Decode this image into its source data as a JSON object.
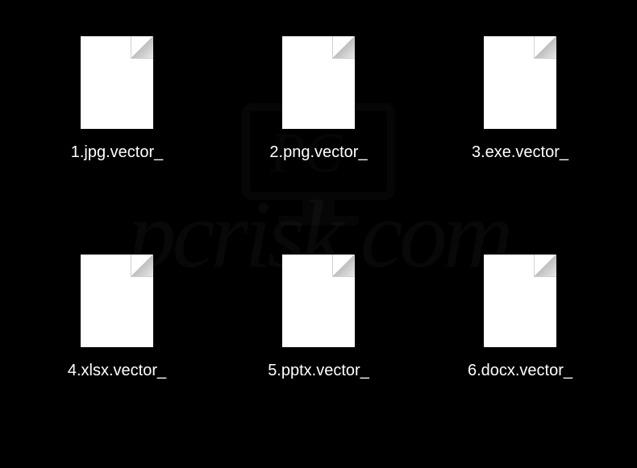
{
  "files": [
    {
      "label": "1.jpg.vector_"
    },
    {
      "label": "2.png.vector_"
    },
    {
      "label": "3.exe.vector_"
    },
    {
      "label": "4.xlsx.vector_"
    },
    {
      "label": "5.pptx.vector_"
    },
    {
      "label": "6.docx.vector_"
    }
  ],
  "watermark": {
    "text": "pcrisk.com"
  }
}
